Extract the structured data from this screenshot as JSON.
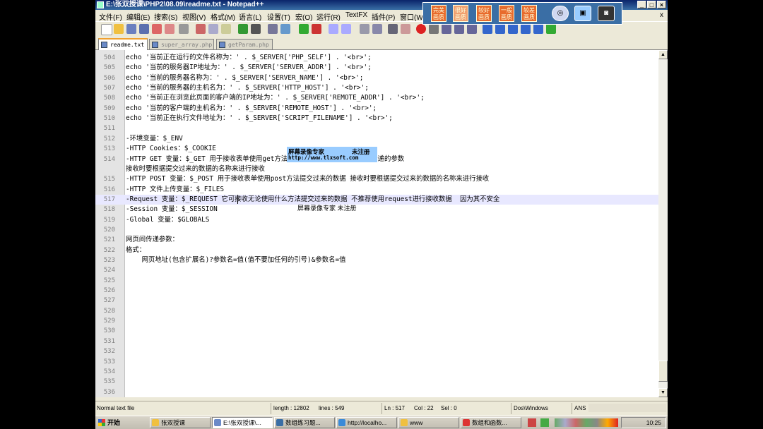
{
  "window": {
    "title": "E:\\张双授课\\PHP2\\08.09\\readme.txt - Notepad++"
  },
  "menu": [
    "文件(F)",
    "编辑(E)",
    "搜索(S)",
    "视图(V)",
    "格式(M)",
    "语言(L)",
    "设置(T)",
    "宏(O)",
    "运行(R)",
    "TextFX",
    "插件(P)",
    "窗口(W"
  ],
  "menu_close": "x",
  "quality_buttons": [
    "完美画质",
    "很好画质",
    "较好画质",
    "一般画质",
    "较差画质"
  ],
  "tabs": [
    {
      "label": "readme.txt",
      "active": true
    },
    {
      "label": "super_array.php",
      "active": false
    },
    {
      "label": "getParam.php",
      "active": false
    }
  ],
  "lines": [
    {
      "num": "504",
      "text": "echo '当前正在运行的文件名称为：' . $_SERVER['PHP_SELF'] . '<br>';"
    },
    {
      "num": "505",
      "text": "echo '当前的服务器IP地址为：' . $_SERVER['SERVER_ADDR'] . '<br>';"
    },
    {
      "num": "506",
      "text": "echo '当前的服务器名称为：' . $_SERVER['SERVER_NAME'] . '<br>';"
    },
    {
      "num": "507",
      "text": "echo '当前的服务器的主机名为：' . $_SERVER['HTTP_HOST'] . '<br>';"
    },
    {
      "num": "508",
      "text": "echo '当前正在浏览此页面的客户端的IP地址为：' . $_SERVER['REMOTE_ADDR'] . '<br>';"
    },
    {
      "num": "509",
      "text": "echo '当前的客户端的主机名为：' . $_SERVER['REMOTE_HOST'] . '<br>';"
    },
    {
      "num": "510",
      "text": "echo '当前正在执行文件地址为：' . $_SERVER['SCRIPT_FILENAME'] . '<br>';"
    },
    {
      "num": "511",
      "text": ""
    },
    {
      "num": "512",
      "text": "-环境变量：$_ENV"
    },
    {
      "num": "513",
      "text": "-HTTP Cookies：$_COOKIE"
    },
    {
      "num": "514",
      "text": "-HTTP GET 变量：$_GET 用于接收表单使用get方法提交过来的数据 或者是网页传递的参数"
    },
    {
      "num": "",
      "text": "接收时要根据提交过来的数据的名称来进行接收"
    },
    {
      "num": "515",
      "text": "-HTTP POST 变量：$_POST 用于接收表单使用post方法提交过来的数据 接收时要根据提交过来的数据的名称来进行接收"
    },
    {
      "num": "516",
      "text": "-HTTP 文件上传变量：$_FILES"
    },
    {
      "num": "517",
      "text": "-Request 变量：$_REQUEST 它可接收无论使用什么方法提交过来的数据 不推荐使用request进行接收数据  因为其不安全",
      "current": true
    },
    {
      "num": "518",
      "text": "-Session 变量：$_SESSION"
    },
    {
      "num": "519",
      "text": "-Global 变量：$GLOBALS"
    },
    {
      "num": "520",
      "text": ""
    },
    {
      "num": "521",
      "text": "网页间传递参数："
    },
    {
      "num": "522",
      "text": "格式："
    },
    {
      "num": "523",
      "text": "    网页地址(包含扩展名)?参数名=值(值不要加任何的引号)&参数名=值"
    },
    {
      "num": "524",
      "text": ""
    },
    {
      "num": "525",
      "text": ""
    },
    {
      "num": "526",
      "text": ""
    },
    {
      "num": "527",
      "text": ""
    },
    {
      "num": "528",
      "text": ""
    },
    {
      "num": "529",
      "text": ""
    },
    {
      "num": "530",
      "text": ""
    },
    {
      "num": "531",
      "text": ""
    },
    {
      "num": "532",
      "text": ""
    },
    {
      "num": "533",
      "text": ""
    },
    {
      "num": "534",
      "text": ""
    },
    {
      "num": "535",
      "text": ""
    },
    {
      "num": "536",
      "text": ""
    }
  ],
  "watermark": {
    "line1": "屏幕录像专家",
    "line1b": "未注册",
    "line2": "http://www.tlxsoft.com",
    "overlay": "屏幕录像专家 未注册"
  },
  "status": {
    "file_type": "Normal text file",
    "length": "length : 12802",
    "lines": "lines : 549",
    "ln": "Ln : 517",
    "col": "Col : 22",
    "sel": "Sel : 0",
    "eol": "Dos\\Windows",
    "enc": "ANS"
  },
  "taskbar": {
    "start": "开始",
    "tasks": [
      {
        "label": "张双授课",
        "color": "#f0c040"
      },
      {
        "label": "E:\\张双授课\\...",
        "color": "#6a8ac8",
        "active": true
      },
      {
        "label": "数组练习题...",
        "color": "#3a6ea5"
      },
      {
        "label": "http://localho...",
        "color": "#3a8ad8"
      },
      {
        "label": "www",
        "color": "#f0c040"
      },
      {
        "label": "数组和函数...",
        "color": "#d33"
      }
    ],
    "clock": "10:25"
  }
}
